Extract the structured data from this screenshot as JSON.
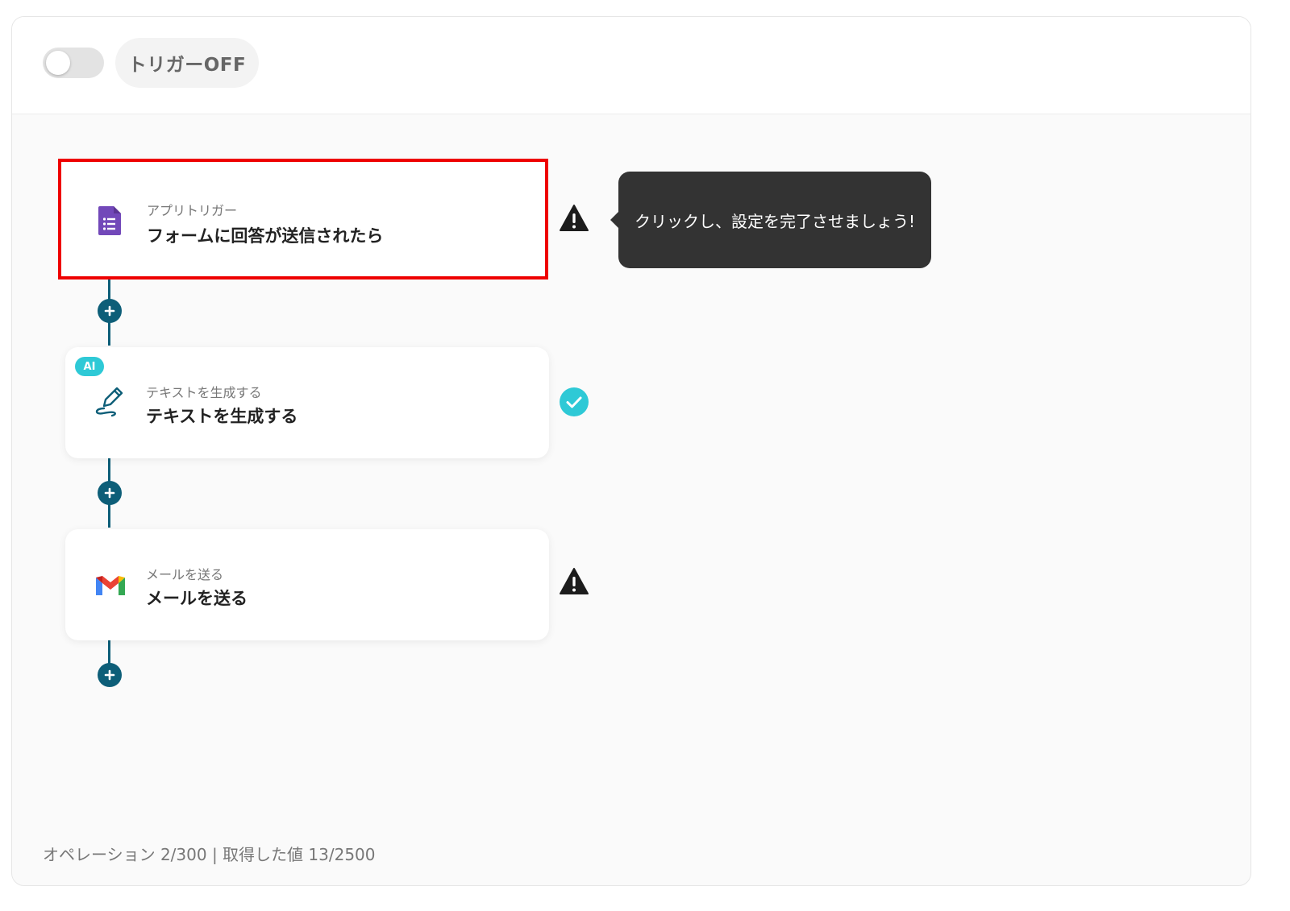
{
  "header": {
    "trigger_label": "トリガーOFF"
  },
  "flow": {
    "steps": [
      {
        "sub": "アプリトリガー",
        "title": "フォームに回答が送信されたら",
        "icon": "google-forms-icon",
        "status": "warning"
      },
      {
        "sub": "テキストを生成する",
        "title": "テキストを生成する",
        "icon": "ai-pen-icon",
        "badge": "AI",
        "status": "done"
      },
      {
        "sub": "メールを送る",
        "title": "メールを送る",
        "icon": "gmail-icon",
        "status": "warning"
      }
    ]
  },
  "tooltip": {
    "text": "クリックし、設定を完了させましょう!"
  },
  "footer": {
    "usage_text": "オペレーション 2/300 | 取得した値 13/2500"
  },
  "colors": {
    "connector": "#0d5e78",
    "highlight": "#ee0000",
    "success": "#2ec9d6",
    "tooltip_bg": "#333333"
  }
}
